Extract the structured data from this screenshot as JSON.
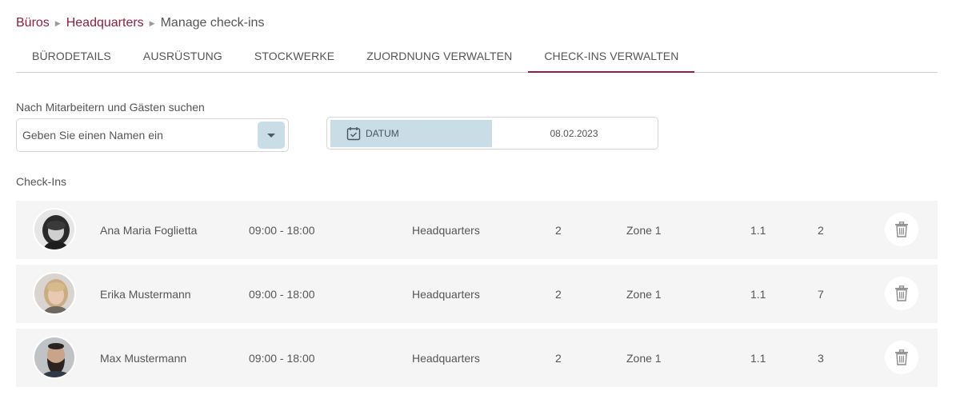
{
  "breadcrumb": {
    "items": [
      {
        "label": "Büros"
      },
      {
        "label": "Headquarters"
      },
      {
        "label": "Manage check-ins"
      }
    ]
  },
  "tabs": [
    {
      "label": "BÜRODETAILS",
      "active": false
    },
    {
      "label": "AUSRÜSTUNG",
      "active": false
    },
    {
      "label": "STOCKWERKE",
      "active": false
    },
    {
      "label": "ZUORDNUNG VERWALTEN",
      "active": false
    },
    {
      "label": "CHECK-INS VERWALTEN",
      "active": true
    }
  ],
  "search": {
    "label": "Nach Mitarbeitern und Gästen suchen",
    "placeholder": "Geben Sie einen Namen ein",
    "dropdown_icon": "chevron-down-icon"
  },
  "date_filter": {
    "label": "DATUM",
    "icon": "calendar-check-icon",
    "value": "08.02.2023"
  },
  "checkins": {
    "title": "Check-Ins",
    "rows": [
      {
        "name": "Ana Maria Foglietta",
        "time": "09:00 - 18:00",
        "office": "Headquarters",
        "floor": "2",
        "zone": "Zone 1",
        "table": "1.1",
        "seat": "2"
      },
      {
        "name": "Erika Mustermann",
        "time": "09:00 - 18:00",
        "office": "Headquarters",
        "floor": "2",
        "zone": "Zone 1",
        "table": "1.1",
        "seat": "7"
      },
      {
        "name": "Max Mustermann",
        "time": "09:00 - 18:00",
        "office": "Headquarters",
        "floor": "2",
        "zone": "Zone 1",
        "table": "1.1",
        "seat": "3"
      }
    ],
    "delete_icon": "trash-icon"
  },
  "colors": {
    "accent": "#8e1f3f",
    "highlight": "#c8dde6",
    "row_background": "#f5f5f5",
    "text": "#555555"
  }
}
